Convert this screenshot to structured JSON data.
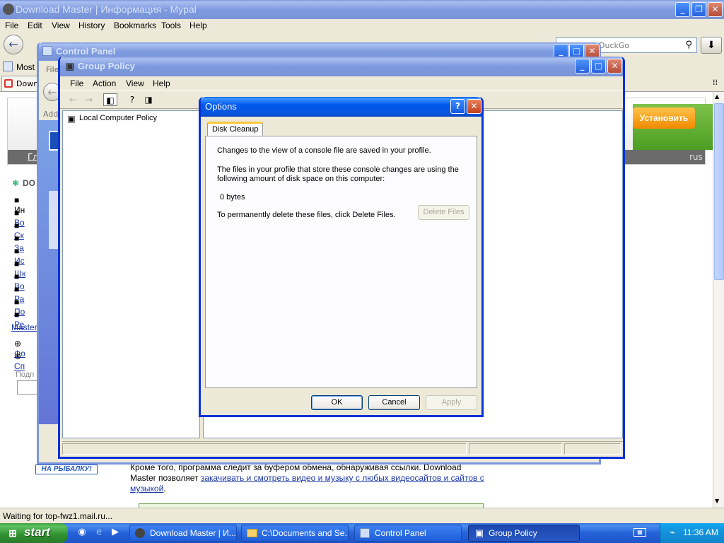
{
  "browser": {
    "title": "Download Master | Информация - Mypal",
    "menu": [
      "File",
      "Edit",
      "View",
      "History",
      "Bookmarks",
      "Tools",
      "Help"
    ],
    "search_placeholder": "DuckGo",
    "bookmark_most": "Most",
    "tab_label": "Downl",
    "status": "Waiting for top-fwz1.mail.ru...",
    "page": {
      "install_button": "Установить",
      "banner_left": "Гл",
      "banner_right": "rus",
      "side_heading": "DO",
      "side_items": [
        "Ин",
        "Во",
        "Ск",
        "За",
        "Ис",
        "Шк",
        "Во",
        "Ра",
        "По",
        "Ре"
      ],
      "side_master": "Master",
      "side_more": [
        "Фо",
        "Сп"
      ],
      "side_label": "Подп",
      "promo": "НА РЫБАЛКУ!",
      "text_line1": "Кроме того, программа следит за буфером обмена, обнаруживая ссылки. Download",
      "text_line2_prefix": "Master позволяет ",
      "text_line2_link": "закачивать и смотреть видео и музыку с любых видеосайтов и сайтов с",
      "text_line3_link": "музыкой",
      "text_line3_suffix": "."
    }
  },
  "control_panel": {
    "title": "Control Panel",
    "menu_file": "File",
    "address_label": "Addr"
  },
  "group_policy": {
    "title": "Group Policy",
    "menu": [
      "File",
      "Action",
      "View",
      "Help"
    ],
    "tree_root": "Local Computer Policy"
  },
  "options_dialog": {
    "title": "Options",
    "tab": "Disk Cleanup",
    "line1": "Changes to the view of a console file are saved in your profile.",
    "line2a": "The files in your profile that store these console changes are using the",
    "line2b": "following amount of disk space on this computer:",
    "size": "0 bytes",
    "delete_prompt": "To permanently delete these files, click Delete Files.",
    "delete_button": "Delete Files",
    "ok": "OK",
    "cancel": "Cancel",
    "apply": "Apply"
  },
  "taskbar": {
    "start": "start",
    "tasks": [
      "Download Master | И...",
      "C:\\Documents and Se...",
      "Control Panel",
      "Group Policy"
    ],
    "clock": "11:36 AM"
  }
}
